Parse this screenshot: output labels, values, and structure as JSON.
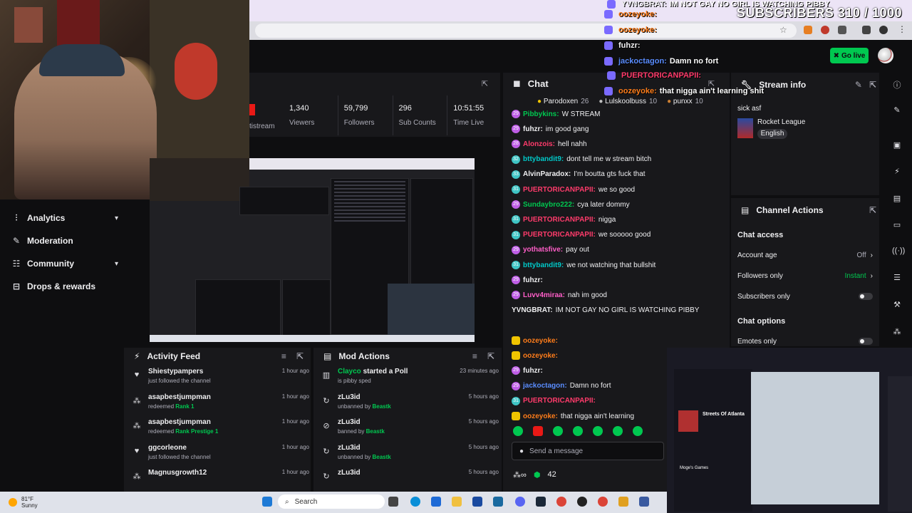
{
  "overlay": {
    "subscribers": "SUBSCRIBERS 310 / 1000",
    "chat_lines": [
      {
        "user": "YVNGBRAT:",
        "text": "IM NOT GAY NO GIRL IS WATCHING PIBBY",
        "color": "#efeff1"
      },
      {
        "user": "oozeyoke:",
        "text": "",
        "color": "#ff7d1a"
      },
      {
        "user": "oozeyoke:",
        "text": "",
        "color": "#ff7d1a"
      },
      {
        "user": "fuhzr:",
        "text": "",
        "color": "#efeff1"
      },
      {
        "user": "jackoctagon:",
        "text": "Damn no fort",
        "color": "#5a8dff"
      },
      {
        "user": "PUERTORICANPAPII:",
        "text": "",
        "color": "#ff3b6b"
      },
      {
        "user": "oozeyoke:",
        "text": "that nigga ain't learning shit",
        "color": "#ff7d1a"
      }
    ]
  },
  "topbar": {
    "go_live": "Go live"
  },
  "sidebar": {
    "items": [
      {
        "label": "Analytics",
        "icon": "analytics-icon",
        "has_chevron": true
      },
      {
        "label": "Moderation",
        "icon": "moderation-icon",
        "has_chevron": false
      },
      {
        "label": "Community",
        "icon": "community-icon",
        "has_chevron": true
      },
      {
        "label": "Drops & rewards",
        "icon": "drops-icon",
        "has_chevron": false
      }
    ]
  },
  "stats": {
    "cut_label": "tistream",
    "items": [
      {
        "value": "1,340",
        "label": "Viewers"
      },
      {
        "value": "59,799",
        "label": "Followers"
      },
      {
        "value": "296",
        "label": "Sub Counts"
      },
      {
        "value": "10:51:55",
        "label": "Time Live"
      }
    ]
  },
  "chat": {
    "title": "Chat",
    "leaders": [
      {
        "name": "Parodoxen",
        "rank": "26"
      },
      {
        "name": "Lulskoolbuss",
        "rank": "10"
      },
      {
        "name": "punxx",
        "rank": "10"
      }
    ],
    "messages": [
      {
        "badge": "29",
        "user": "Pibbykins:",
        "text": "W STREAM",
        "color": "#00c850"
      },
      {
        "badge": "29",
        "user": "fuhzr:",
        "text": "im good gang",
        "color": "#efeff1"
      },
      {
        "badge": "28",
        "user": "Alonzois:",
        "text": "hell nahh",
        "color": "#ff3b6b"
      },
      {
        "badge": "32",
        "user": "bttybandit9:",
        "text": "dont tell me w stream bitch",
        "color": "#00c8c8"
      },
      {
        "badge": "33",
        "user": "AlvinParadox:",
        "text": "I'm boutta gts fuck that",
        "color": "#efeff1"
      },
      {
        "badge": "31",
        "user": "PUERTORICANPAPII:",
        "text": "we so good",
        "color": "#ff3b6b"
      },
      {
        "badge": "29",
        "user": "Sundaybro222:",
        "text": "cya later dommy",
        "color": "#00c850"
      },
      {
        "badge": "31",
        "user": "PUERTORICANPAPII:",
        "text": "nigga",
        "color": "#ff3b6b"
      },
      {
        "badge": "31",
        "user": "PUERTORICANPAPII:",
        "text": "we sooooo good",
        "color": "#ff3b6b"
      },
      {
        "badge": "29",
        "user": "yothatsfive:",
        "text": "pay out",
        "color": "#ff5ec8"
      },
      {
        "badge": "31",
        "user": "bttybandit9:",
        "text": "we not watching that bullshit",
        "color": "#00c8c8"
      },
      {
        "badge": "29",
        "user": "fuhzr:",
        "text": "",
        "color": "#efeff1"
      },
      {
        "badge": "29",
        "user": "Luvv4miraa:",
        "text": "nah im good",
        "color": "#ff5ec8"
      },
      {
        "badge": "",
        "user": "YVNGBRAT:",
        "text": "IM NOT GAY NO GIRL IS WATCHING PIBBY",
        "color": "#efeff1"
      },
      {
        "badge": "",
        "user": "",
        "text": "",
        "color": "#efeff1"
      },
      {
        "badge": "crown",
        "user": "oozeyoke:",
        "text": "",
        "color": "#ff7d1a"
      },
      {
        "badge": "crown",
        "user": "oozeyoke:",
        "text": "",
        "color": "#ff7d1a"
      },
      {
        "badge": "29",
        "user": "fuhzr:",
        "text": "",
        "color": "#efeff1"
      },
      {
        "badge": "29",
        "user": "jackoctagon:",
        "text": "Damn no fort",
        "color": "#5a8dff"
      },
      {
        "badge": "31",
        "user": "PUERTORICANPAPII:",
        "text": "",
        "color": "#ff3b6b"
      },
      {
        "badge": "crown",
        "user": "oozeyoke:",
        "text": "that nigga ain't learning",
        "color": "#ff7d1a"
      }
    ],
    "input_placeholder": "Send a message",
    "points": "42"
  },
  "stream_info": {
    "title": "Stream info",
    "stream_title": "sick asf",
    "game": "Rocket League",
    "language": "English"
  },
  "channel_actions": {
    "title": "Channel Actions",
    "chat_access": "Chat access",
    "rows": [
      {
        "label": "Account age",
        "value": "Off",
        "type": "value"
      },
      {
        "label": "Followers only",
        "value": "Instant",
        "type": "value-green"
      },
      {
        "label": "Subscribers only",
        "value": "",
        "type": "toggle"
      }
    ],
    "chat_options": "Chat options",
    "rows2": [
      {
        "label": "Emotes only",
        "value": "",
        "type": "toggle"
      }
    ]
  },
  "activity_feed": {
    "title": "Activity Feed",
    "items": [
      {
        "icon": "heart-icon",
        "name": "Shiestypampers",
        "sub": "just followed the channel",
        "highlight": "",
        "time": "1 hour ago"
      },
      {
        "icon": "reward-icon",
        "name": "asapbestjumpman",
        "sub": "redeemed",
        "highlight": "Rank 1",
        "time": "1 hour ago"
      },
      {
        "icon": "reward-icon",
        "name": "asapbestjumpman",
        "sub": "redeemed",
        "highlight": "Rank Prestige 1",
        "time": "1 hour ago"
      },
      {
        "icon": "heart-icon",
        "name": "ggcorleone",
        "sub": "just followed the channel",
        "highlight": "",
        "time": "1 hour ago"
      },
      {
        "icon": "reward-icon",
        "name": "Magnusgrowth12",
        "sub": "",
        "highlight": "",
        "time": "1 hour ago"
      }
    ]
  },
  "mod_actions": {
    "title": "Mod Actions",
    "items": [
      {
        "icon": "poll-icon",
        "name": "Clayco",
        "name_suffix": "started a Poll",
        "sub": "is pibby sped",
        "mod": "",
        "time": "23 minutes ago"
      },
      {
        "icon": "unban-icon",
        "name": "zLu3id",
        "name_suffix": "",
        "sub": "unbanned by",
        "mod": "Beastk",
        "time": "5 hours ago"
      },
      {
        "icon": "ban-icon",
        "name": "zLu3id",
        "name_suffix": "",
        "sub": "banned by",
        "mod": "Beastk",
        "time": "5 hours ago"
      },
      {
        "icon": "unban-icon",
        "name": "zLu3id",
        "name_suffix": "",
        "sub": "unbanned by",
        "mod": "Beastk",
        "time": "5 hours ago"
      },
      {
        "icon": "unban-icon",
        "name": "zLu3id",
        "name_suffix": "",
        "sub": "",
        "mod": "",
        "time": "5 hours ago"
      }
    ]
  },
  "second_screen": {
    "streets_title": "Streets Of Atlanta",
    "moges": "Moge's Games"
  },
  "taskbar": {
    "temp": "81°F",
    "condition": "Sunny",
    "search": "Search"
  }
}
